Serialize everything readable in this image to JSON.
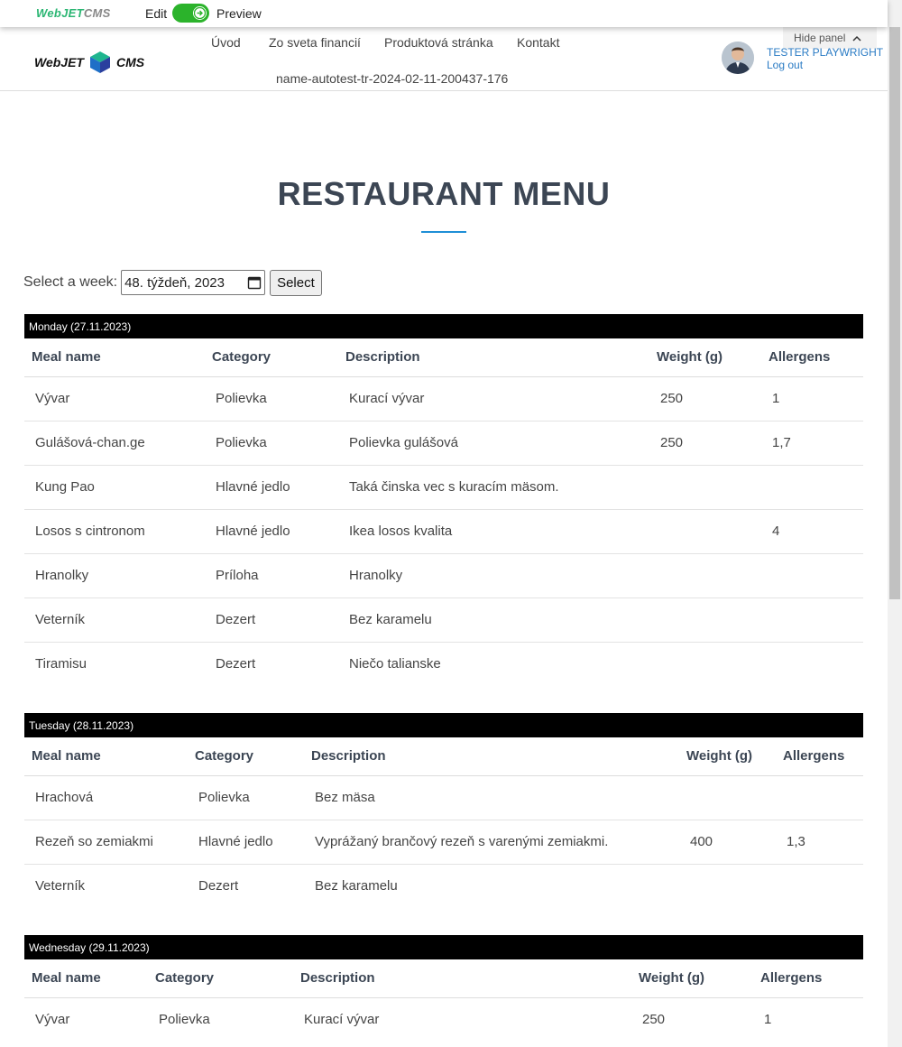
{
  "edit_bar": {
    "logo_a": "WebJET",
    "logo_b": "CMS",
    "edit_label": "Edit",
    "preview_label": "Preview"
  },
  "header": {
    "logo_a": "WebJET",
    "logo_b": "CMS",
    "nav": [
      "Úvod",
      "Zo sveta financií",
      "Produktová stránka",
      "Kontakt"
    ],
    "nav_sub": "name-autotest-tr-2024-02-11-200437-176",
    "hide_panel": "Hide panel",
    "user_name": "TESTER PLAYWRIGHT",
    "logout": "Log out"
  },
  "page": {
    "title": "RESTAURANT MENU",
    "week_label": "Select a week:",
    "week_value": "48. týždeň, 2023",
    "select_button": "Select"
  },
  "columns": {
    "meal": "Meal name",
    "category": "Category",
    "description": "Description",
    "weight": "Weight (g)",
    "allergens": "Allergens"
  },
  "days": [
    {
      "header": "Monday (27.11.2023)",
      "rows": [
        {
          "meal": "Vývar",
          "category": "Polievka",
          "description": "Kurací vývar",
          "weight": "250",
          "allergens": "1"
        },
        {
          "meal": "Gulášová-chan.ge",
          "category": "Polievka",
          "description": "Polievka gulášová",
          "weight": "250",
          "allergens": "1,7"
        },
        {
          "meal": "Kung Pao",
          "category": "Hlavné jedlo",
          "description": "Taká činska vec s kuracím mäsom.",
          "weight": "",
          "allergens": ""
        },
        {
          "meal": "Losos s cintronom",
          "category": "Hlavné jedlo",
          "description": "Ikea losos kvalita",
          "weight": "",
          "allergens": "4"
        },
        {
          "meal": "Hranolky",
          "category": "Príloha",
          "description": "Hranolky",
          "weight": "",
          "allergens": ""
        },
        {
          "meal": "Veterník",
          "category": "Dezert",
          "description": "Bez karamelu",
          "weight": "",
          "allergens": ""
        },
        {
          "meal": "Tiramisu",
          "category": "Dezert",
          "description": "Niečo talianske",
          "weight": "",
          "allergens": ""
        }
      ]
    },
    {
      "header": "Tuesday (28.11.2023)",
      "rows": [
        {
          "meal": "Hrachová",
          "category": "Polievka",
          "description": "Bez mäsa",
          "weight": "",
          "allergens": ""
        },
        {
          "meal": "Rezeň so zemiakmi",
          "category": "Hlavné jedlo",
          "description": "Vyprážaný brančový rezeň s varenými zemiakmi.",
          "weight": "400",
          "allergens": "1,3"
        },
        {
          "meal": "Veterník",
          "category": "Dezert",
          "description": "Bez karamelu",
          "weight": "",
          "allergens": ""
        }
      ]
    },
    {
      "header": "Wednesday (29.11.2023)",
      "rows": [
        {
          "meal": "Vývar",
          "category": "Polievka",
          "description": "Kurací vývar",
          "weight": "250",
          "allergens": "1"
        }
      ]
    }
  ]
}
